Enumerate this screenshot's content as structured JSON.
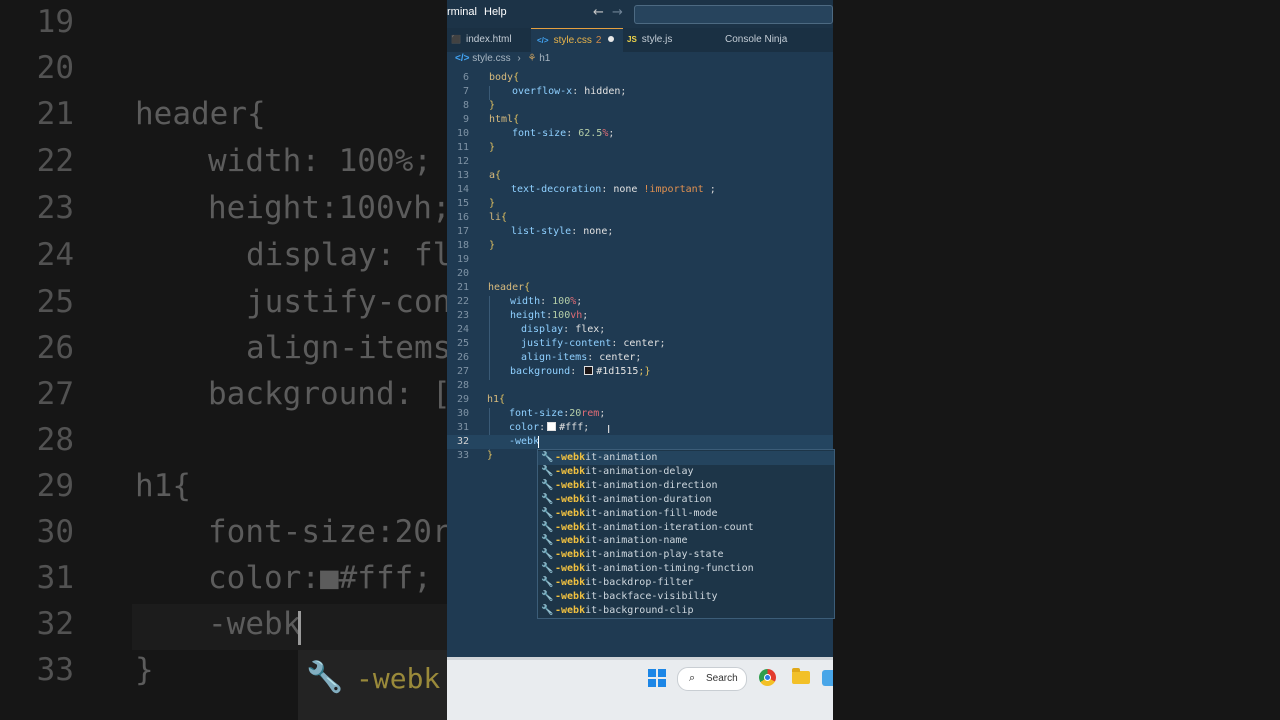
{
  "background_zoom": {
    "lines": [
      {
        "ln": "19",
        "text": "",
        "indent": 0
      },
      {
        "ln": "20",
        "text": "",
        "indent": 0
      },
      {
        "ln": "21",
        "text": "header{",
        "indent": 0
      },
      {
        "ln": "22",
        "text": "width: 100%;",
        "indent": 1
      },
      {
        "ln": "23",
        "text": "height:100vh;",
        "indent": 1
      },
      {
        "ln": "24",
        "text": "display: fl",
        "indent": 2
      },
      {
        "ln": "25",
        "text": "justify-con",
        "indent": 2
      },
      {
        "ln": "26",
        "text": "align-items",
        "indent": 2
      },
      {
        "ln": "27",
        "text": "background: [",
        "indent": 1
      },
      {
        "ln": "28",
        "text": "",
        "indent": 0
      },
      {
        "ln": "29",
        "text": "h1{",
        "indent": 0
      },
      {
        "ln": "30",
        "text": "font-size:20r",
        "indent": 1
      },
      {
        "ln": "31",
        "text": "color:■#fff;",
        "indent": 1
      },
      {
        "ln": "32",
        "text": "-webk",
        "indent": 1
      },
      {
        "ln": "33",
        "text": "}",
        "indent": 0
      }
    ],
    "suggest_text": "-webk"
  },
  "titlebar": {
    "menu_terminal": "rminal",
    "menu_help": "Help",
    "back_icon": "arrow-left-icon",
    "forward_icon": "arrow-right-icon"
  },
  "tabs": [
    {
      "label": "index.html",
      "icon": "html-file-icon",
      "active": false
    },
    {
      "label": "style.css",
      "icon": "css-file-icon",
      "active": true,
      "problems": "2"
    },
    {
      "label": "style.js",
      "icon": "js-file-icon",
      "active": false
    },
    {
      "label": "Console Ninja",
      "active": false
    }
  ],
  "breadcrumb": {
    "file": "style.css",
    "symbol": "h1"
  },
  "code_lines": [
    {
      "ln": "6"
    },
    {
      "ln": "7"
    },
    {
      "ln": "8"
    },
    {
      "ln": "9"
    },
    {
      "ln": "10"
    },
    {
      "ln": "11"
    },
    {
      "ln": "12"
    },
    {
      "ln": "13"
    },
    {
      "ln": "14"
    },
    {
      "ln": "15"
    },
    {
      "ln": "16"
    },
    {
      "ln": "17"
    },
    {
      "ln": "18"
    },
    {
      "ln": "19"
    },
    {
      "ln": "20"
    },
    {
      "ln": "21"
    },
    {
      "ln": "22"
    },
    {
      "ln": "23"
    },
    {
      "ln": "24"
    },
    {
      "ln": "25"
    },
    {
      "ln": "26"
    },
    {
      "ln": "27"
    },
    {
      "ln": "28"
    },
    {
      "ln": "29"
    },
    {
      "ln": "30"
    },
    {
      "ln": "31"
    },
    {
      "ln": "32"
    },
    {
      "ln": "33"
    }
  ],
  "code": {
    "l6": [
      "body",
      "{"
    ],
    "l7": [
      "overflow-x",
      ": ",
      "hidden",
      ";"
    ],
    "l8": [
      "}"
    ],
    "l9": [
      "html",
      "{"
    ],
    "l10": [
      "font-size",
      ": ",
      "62.5",
      "%",
      ";"
    ],
    "l11": [
      "}"
    ],
    "l13": [
      "a",
      "{"
    ],
    "l14": [
      "text-decoration",
      ": ",
      "none ",
      "!important",
      " ;"
    ],
    "l15": [
      "}"
    ],
    "l16": [
      "li",
      "{"
    ],
    "l17": [
      "list-style",
      ": ",
      "none",
      ";"
    ],
    "l18": [
      "}"
    ],
    "l21": [
      "header",
      "{"
    ],
    "l22": [
      "width",
      ": ",
      "100",
      "%",
      ";"
    ],
    "l23": [
      "height",
      ":",
      "100",
      "vh",
      ";"
    ],
    "l24": [
      "display",
      ": ",
      "flex",
      ";"
    ],
    "l25": [
      "justify-content",
      ": ",
      "center",
      ";"
    ],
    "l26": [
      "align-items",
      ": ",
      "center",
      ";"
    ],
    "l27": [
      "background",
      ": ",
      "#1d1515",
      ";}"
    ],
    "l29": [
      "h1",
      "{"
    ],
    "l30": [
      "font-size",
      ":",
      "20",
      "rem",
      ";"
    ],
    "l31": [
      "color",
      ":",
      "#fff",
      ";"
    ],
    "l32": [
      "-webk"
    ],
    "l33": [
      "}"
    ]
  },
  "swatches": {
    "background": "#1d1515",
    "color": "#ffffff"
  },
  "suggestions": {
    "match": "-webk",
    "items": [
      {
        "rest": "it-animation"
      },
      {
        "rest": "it-animation-delay"
      },
      {
        "rest": "it-animation-direction"
      },
      {
        "rest": "it-animation-duration"
      },
      {
        "rest": "it-animation-fill-mode"
      },
      {
        "rest": "it-animation-iteration-count"
      },
      {
        "rest": "it-animation-name"
      },
      {
        "rest": "it-animation-play-state"
      },
      {
        "rest": "it-animation-timing-function"
      },
      {
        "rest": "it-backdrop-filter"
      },
      {
        "rest": "it-backface-visibility"
      },
      {
        "rest": "it-background-clip"
      }
    ],
    "icon": "wrench-icon"
  },
  "taskbar": {
    "search_label": "Search",
    "apps": [
      "windows-start-icon",
      "search-icon",
      "chrome-icon",
      "file-explorer-icon",
      "app-icon"
    ]
  },
  "colors": {
    "editor_bg": "#1f3a52",
    "accent": "#e4a040",
    "taskbar_bg": "#e9ecef"
  }
}
